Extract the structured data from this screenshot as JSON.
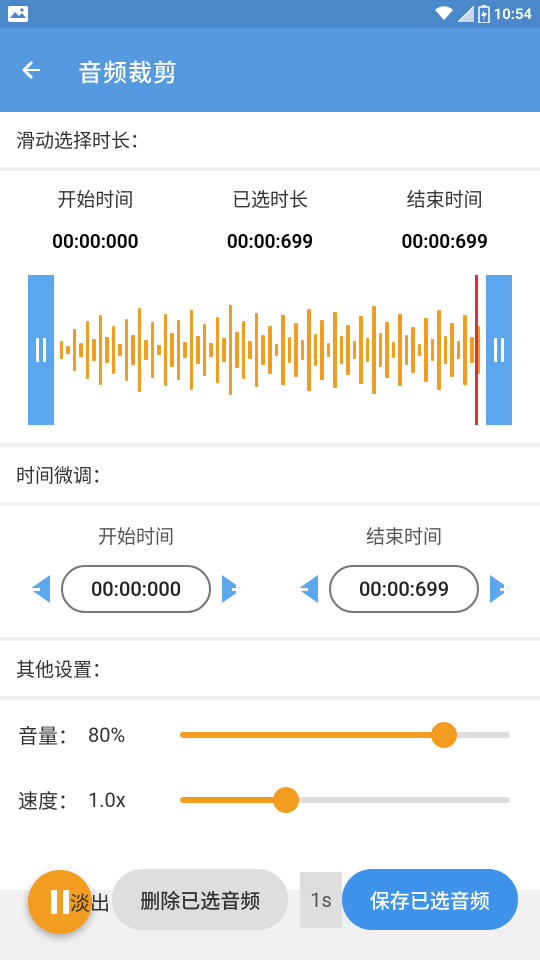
{
  "statusbar": {
    "time": "10:54"
  },
  "appbar": {
    "title": "音频裁剪"
  },
  "slide_select": "滑动选择时长：",
  "times": {
    "start": {
      "label": "开始时间",
      "value": "00:00:000"
    },
    "dur": {
      "label": "已选时长",
      "value": "00:00:699"
    },
    "end": {
      "label": "结束时间",
      "value": "00:00:699"
    }
  },
  "fine_header": "时间微调：",
  "fine": {
    "start": {
      "label": "开始时间",
      "value": "00:00:000"
    },
    "end": {
      "label": "结束时间",
      "value": "00:00:699"
    }
  },
  "other_header": "其他设置：",
  "volume": {
    "label": "音量：",
    "value": "80%",
    "percent": 80
  },
  "speed": {
    "label": "速度：",
    "value": "1.0x",
    "percent": 32
  },
  "fadeout": {
    "label": "淡出",
    "badge": "1s"
  },
  "buttons": {
    "delete": "删除已选音频",
    "save": "保存已选音频"
  }
}
